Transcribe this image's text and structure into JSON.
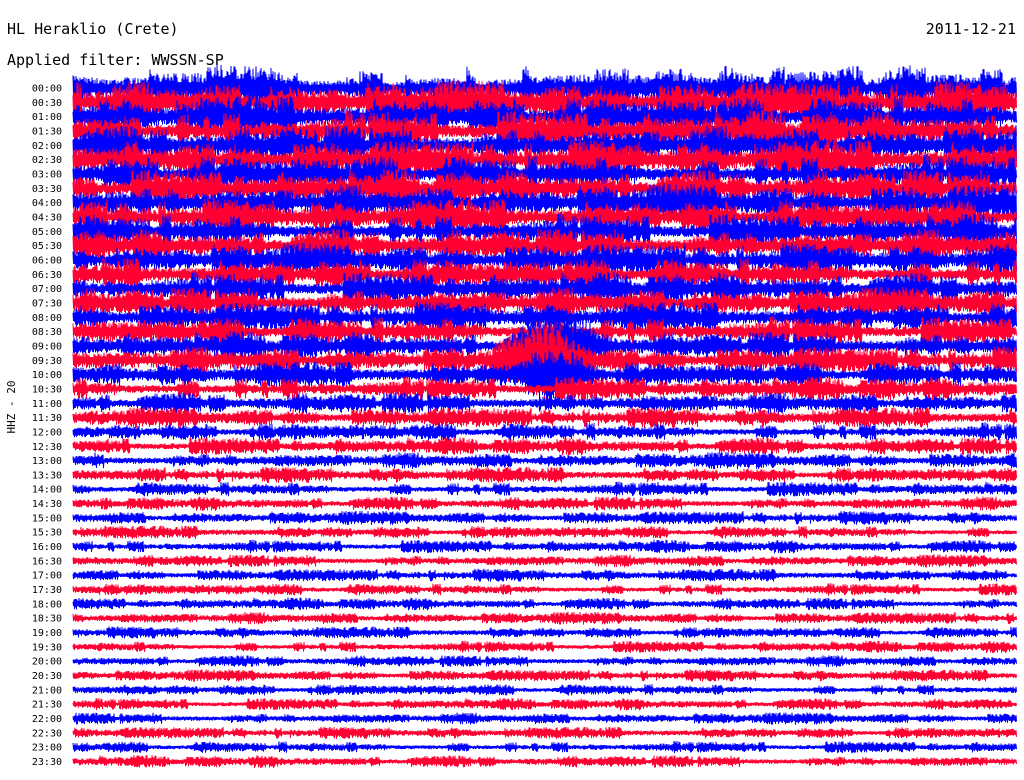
{
  "header": {
    "station": "HL Heraklio (Crete)",
    "date": "2011-12-21",
    "filter_label": "Applied filter: WWSSN-SP"
  },
  "channel": "HHZ - 20",
  "colors": {
    "trace_a": "#0000ff",
    "trace_b": "#ff0033",
    "background": "#ffffff",
    "text": "#000000"
  },
  "chart_data": {
    "type": "line",
    "description_type": "helicorder",
    "rows": [
      "00:00",
      "00:30",
      "01:00",
      "01:30",
      "02:00",
      "02:30",
      "03:00",
      "03:30",
      "04:00",
      "04:30",
      "05:00",
      "05:30",
      "06:00",
      "06:30",
      "07:00",
      "07:30",
      "08:00",
      "08:30",
      "09:00",
      "09:30",
      "10:00",
      "10:30",
      "11:00",
      "11:30",
      "12:00",
      "12:30",
      "13:00",
      "13:30",
      "14:00",
      "14:30",
      "15:00",
      "15:30",
      "16:00",
      "16:30",
      "17:00",
      "17:30",
      "18:00",
      "18:30",
      "19:00",
      "19:30",
      "20:00",
      "20:30",
      "21:00",
      "21:30",
      "22:00",
      "22:30",
      "23:00",
      "23:30"
    ],
    "row_colors": [
      "trace_a",
      "trace_b"
    ],
    "relative_amplitude": [
      1.0,
      0.97,
      0.95,
      0.94,
      0.92,
      0.9,
      0.88,
      0.86,
      0.84,
      0.82,
      0.8,
      0.78,
      0.76,
      0.75,
      0.74,
      0.72,
      0.7,
      0.68,
      0.66,
      0.64,
      0.6,
      0.55,
      0.5,
      0.46,
      0.42,
      0.4,
      0.38,
      0.36,
      0.34,
      0.32,
      0.31,
      0.3,
      0.3,
      0.29,
      0.29,
      0.28,
      0.28,
      0.28,
      0.27,
      0.27,
      0.27,
      0.27,
      0.27,
      0.27,
      0.27,
      0.27,
      0.27,
      0.28
    ],
    "events": [
      {
        "row": "09:00",
        "position": 0.52,
        "strength": 3.0
      },
      {
        "row": "09:30",
        "position": 0.5,
        "strength": 3.5
      },
      {
        "row": "10:00",
        "position": 0.51,
        "strength": 2.5
      }
    ]
  }
}
